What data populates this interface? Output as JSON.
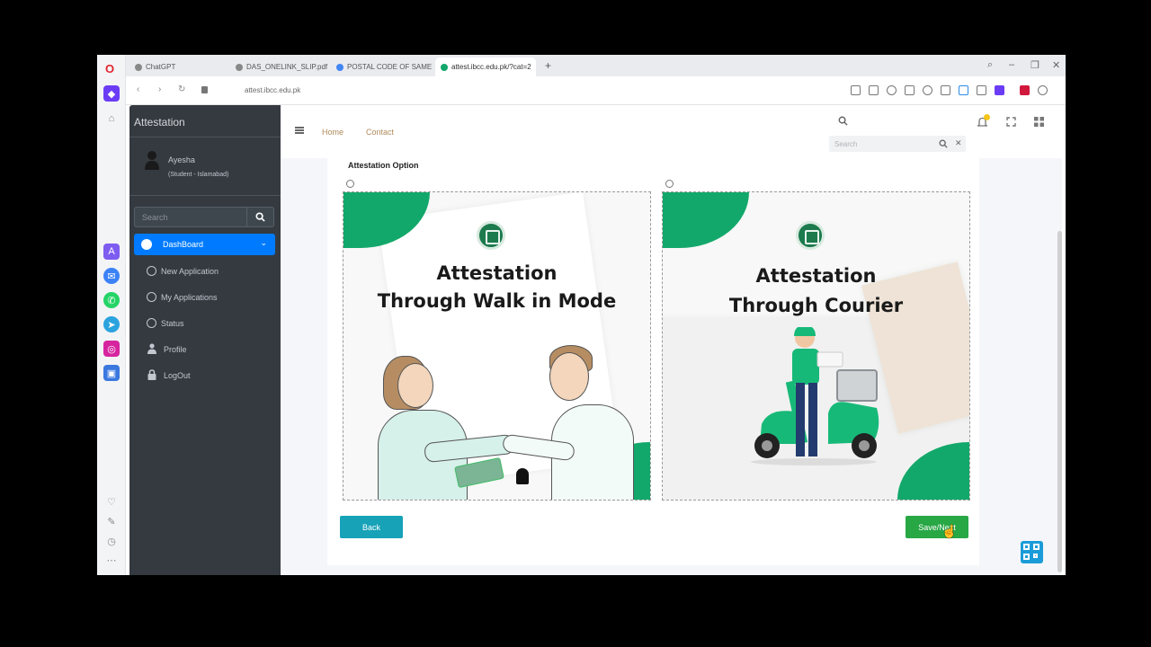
{
  "browser": {
    "tabs": [
      {
        "label": "ChatGPT",
        "active": false
      },
      {
        "label": "DAS_ONELINK_SLIP.pdf",
        "active": false
      },
      {
        "label": "POSTAL CODE OF SAMEF",
        "active": false
      },
      {
        "label": "attest.ibcc.edu.pk/?cat=2",
        "active": true
      }
    ],
    "new_tab": "+",
    "url": "attest.ibcc.edu.pk",
    "nav": {
      "back": "‹",
      "forward": "›",
      "reload": "↻"
    },
    "window": {
      "search": "⌕",
      "minimize": "–",
      "restore": "❐",
      "close": "✕"
    }
  },
  "sidebar": {
    "brand": "Attestation",
    "user": {
      "name": "Ayesha",
      "role": "(Student - Islamabad)"
    },
    "search_placeholder": "Search",
    "active_item": {
      "label": "DashBoard"
    },
    "items": [
      {
        "label": "New Application",
        "icon": "circle-icon"
      },
      {
        "label": "My Applications",
        "icon": "circle-icon"
      },
      {
        "label": "Status",
        "icon": "circle-icon"
      },
      {
        "label": "Profile",
        "icon": "user-icon"
      },
      {
        "label": "LogOut",
        "icon": "lock-icon"
      }
    ]
  },
  "topnav": {
    "links": [
      "Home",
      "Contact"
    ],
    "search_placeholder": "Search"
  },
  "main": {
    "section_title": "Attestation Option",
    "options": [
      {
        "title_line1": "Attestation",
        "title_line2": "Through Walk in Mode",
        "selected": false
      },
      {
        "title_line1": "Attestation",
        "title_line2": "Through Courier",
        "selected": false
      }
    ],
    "back_label": "Back",
    "save_label": "Save/Next"
  },
  "colors": {
    "sidebar_bg": "#343a40",
    "active_nav": "#007bff",
    "brand_green": "#13a86b",
    "back_button": "#17a2b8",
    "save_button": "#28a745",
    "link": "#b08a5b"
  }
}
